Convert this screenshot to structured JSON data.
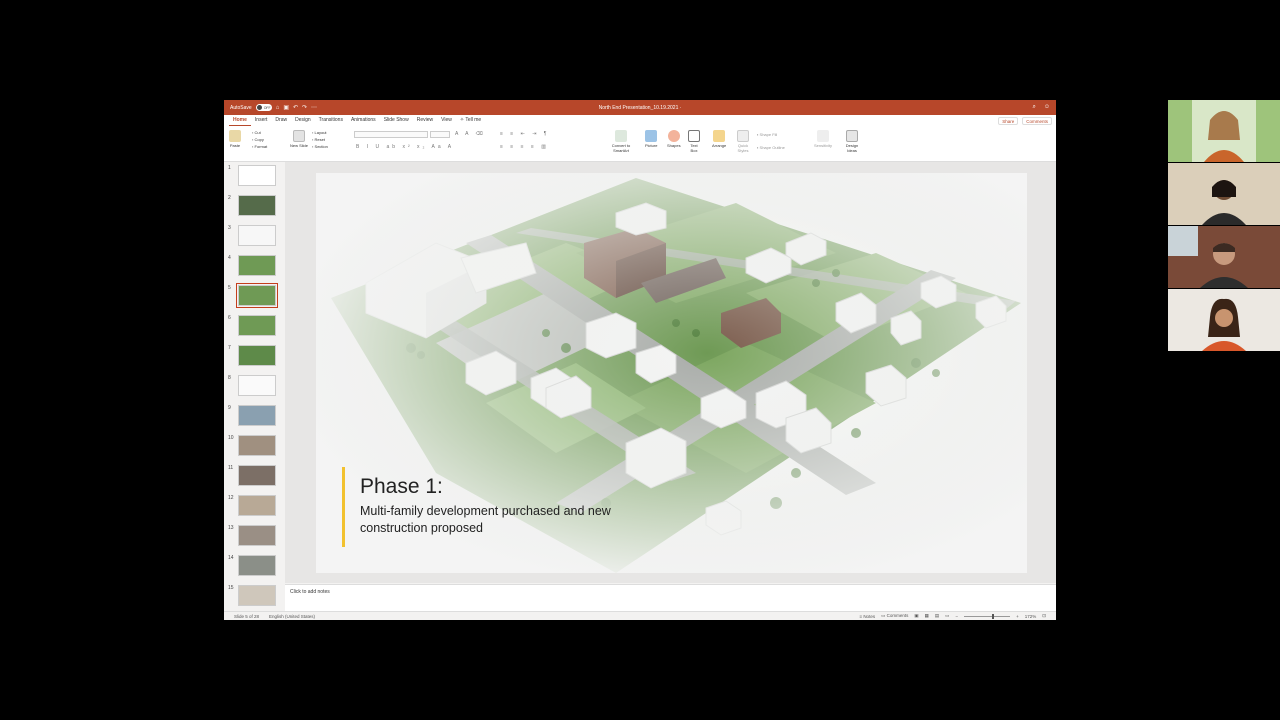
{
  "titlebar": {
    "autosave_label": "AutoSave",
    "autosave_state": "OFF",
    "document_title": "North End Presentation_10.19.2021 ·"
  },
  "tabs": [
    "Home",
    "Insert",
    "Draw",
    "Design",
    "Transitions",
    "Animations",
    "Slide Show",
    "Review",
    "View",
    "Tell me"
  ],
  "tab_actions": {
    "share": "Share",
    "comments": "Comments"
  },
  "ribbon": {
    "paste": "Paste",
    "clipboard": [
      "Cut",
      "Copy",
      "Format"
    ],
    "new_slide": "New Slide",
    "slide_opts": [
      "Layout",
      "Reset",
      "Section"
    ],
    "convert": "Convert to SmartArt",
    "picture": "Picture",
    "shapes": "Shapes",
    "textbox": "Text Box",
    "arrange": "Arrange",
    "quick_styles": "Quick Styles",
    "shape_fill": "Shape Fill",
    "shape_outline": "Shape Outline",
    "sensitivity": "Sensitivity",
    "design_ideas": "Design Ideas"
  },
  "slides": [
    {
      "num": "1"
    },
    {
      "num": "2"
    },
    {
      "num": "3"
    },
    {
      "num": "4"
    },
    {
      "num": "5"
    },
    {
      "num": "6"
    },
    {
      "num": "7"
    },
    {
      "num": "8"
    },
    {
      "num": "9"
    },
    {
      "num": "10"
    },
    {
      "num": "11"
    },
    {
      "num": "12"
    },
    {
      "num": "13"
    },
    {
      "num": "14"
    },
    {
      "num": "15"
    }
  ],
  "selected_slide": 5,
  "slide": {
    "title": "Phase 1:",
    "description": "Multi-family development purchased and new construction proposed"
  },
  "notes": {
    "placeholder": "Click to add notes"
  },
  "status": {
    "slide_info": "Slide 5 of 28",
    "language": "English (United States)",
    "notes": "Notes",
    "comments": "Comments",
    "zoom": "172%"
  },
  "colors": {
    "accent": "#b7472a",
    "caption_bar": "#f2c12e"
  }
}
